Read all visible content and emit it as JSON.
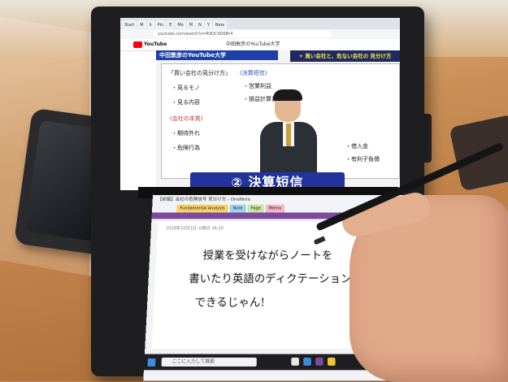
{
  "browser": {
    "tabs": [
      "Start",
      "M",
      "h",
      "Pin",
      "E",
      "Mo",
      "M",
      "N",
      "Y",
      "New"
    ],
    "url": "youtube.com/watch?v=R9QC9D6Br4"
  },
  "youtube": {
    "logo_text": "YouTube",
    "channel_title": "中田敦彦のYouTube大学"
  },
  "video": {
    "header": "中田敦彦のYouTube大学",
    "banner": "+ 買い会社と、危ない会社の 見分け方",
    "caption": "② 決算短信",
    "whiteboard_notes": [
      "「買い会社の見分け方」",
      "・見るモノ",
      "・見る内容",
      "(会社の本質)",
      "・期待外れ",
      "・危険行為",
      "(決算短信)",
      "・営業利益",
      "・損益計算書",
      "・借入金",
      "・有利子負債"
    ]
  },
  "onenote": {
    "window_title": "【前編】会社の危険信号 見分け方 - OneNote",
    "tabs": [
      "Fundamental Analysis",
      "Note",
      "Page",
      "Memo"
    ],
    "page_date": "2019年10月1日 火曜日 16:20",
    "handwriting": [
      "授業を受けながらノートを",
      "書いたり英語のディクテーション",
      "できるじゃん!"
    ]
  },
  "taskbar": {
    "search_placeholder": "ここに入力して検索"
  },
  "colors": {
    "youtube_red": "#ff0000",
    "caption_blue": "#23339c",
    "onenote_purple": "#7b4a9c"
  }
}
